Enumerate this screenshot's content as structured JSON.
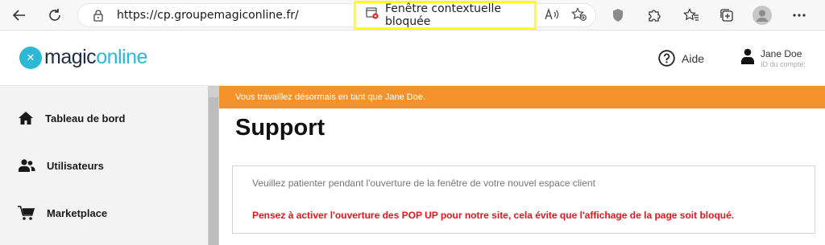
{
  "browser": {
    "url": "https://cp.groupemagiconline.fr/",
    "popup_blocked_label": "Fenêtre contextuelle bloquée"
  },
  "header": {
    "logo_part1": "magic",
    "logo_part2": "online",
    "help_label": "Aide",
    "user_name": "Jane Doe",
    "account_label": "ID du compte:"
  },
  "sidebar": {
    "items": [
      {
        "label": "Tableau de bord",
        "icon": "home-icon"
      },
      {
        "label": "Utilisateurs",
        "icon": "users-icon"
      },
      {
        "label": "Marketplace",
        "icon": "cart-icon"
      }
    ]
  },
  "main": {
    "banner": "Vous travaillez désormais en tant que Jane Doe.",
    "title": "Support",
    "message": "Veuillez patienter pendant l'ouverture de la fenêtre de votre nouvel espace client",
    "warning": "Pensez à activer l'ouverture des POP UP pour notre site, cela évite que l'affichage de la page soit bloqué."
  },
  "colors": {
    "banner": "#f6922c",
    "brand": "#2db8d6",
    "warning": "#e8141b",
    "highlight": "#ffff1a"
  }
}
